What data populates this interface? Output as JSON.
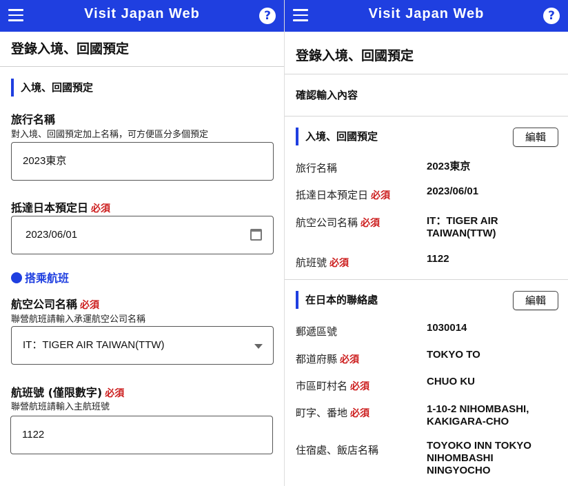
{
  "app": {
    "title": "Visit Japan Web",
    "help_symbol": "?"
  },
  "left": {
    "page_title": "登錄入境、回國預定",
    "section_title": "入境、回國預定",
    "trip_name": {
      "label": "旅行名稱",
      "hint": "對入境、回國預定加上名稱，可方便區分多個預定",
      "value": "2023東京"
    },
    "arrival_date": {
      "label": "抵達日本預定日",
      "required": "必須",
      "value": "2023/06/01"
    },
    "flight_section": "搭乘航班",
    "airline": {
      "label": "航空公司名稱",
      "required": "必須",
      "hint": "聯營航班請輸入承運航空公司名稱",
      "value": "IT：TIGER AIR TAIWAN(TTW)"
    },
    "flight_no": {
      "label": "航班號 (僅限數字)",
      "required": "必須",
      "hint": "聯營航班請輸入主航班號",
      "value": "1122"
    }
  },
  "right": {
    "page_title": "登錄入境、回國預定",
    "confirm_title": "確認輸入內容",
    "edit_label": "編輯",
    "entry_section": {
      "title": "入境、回國預定",
      "rows": [
        {
          "label": "旅行名稱",
          "required": "",
          "value": "2023東京"
        },
        {
          "label": "抵達日本預定日",
          "required": "必須",
          "value": "2023/06/01"
        },
        {
          "label": "航空公司名稱",
          "required": "必須",
          "value": "IT：TIGER AIR TAIWAN(TTW)"
        },
        {
          "label": "航班號",
          "required": "必須",
          "value": "1122"
        }
      ]
    },
    "contact_section": {
      "title": "在日本的聯絡處",
      "rows": [
        {
          "label": "郵遞區號",
          "required": "",
          "value": "1030014"
        },
        {
          "label": "都道府縣",
          "required": "必須",
          "value": "TOKYO TO"
        },
        {
          "label": "市區町村名",
          "required": "必須",
          "value": "CHUO KU"
        },
        {
          "label": "町字、番地",
          "required": "必須",
          "value": "1-10-2 NIHOMBASHI, KAKIGARA-CHO"
        },
        {
          "label": "住宿處、飯店名稱",
          "required": "",
          "value": "TOYOKO INN TOKYO NIHOMBASHI NINGYOCHO"
        }
      ]
    }
  }
}
